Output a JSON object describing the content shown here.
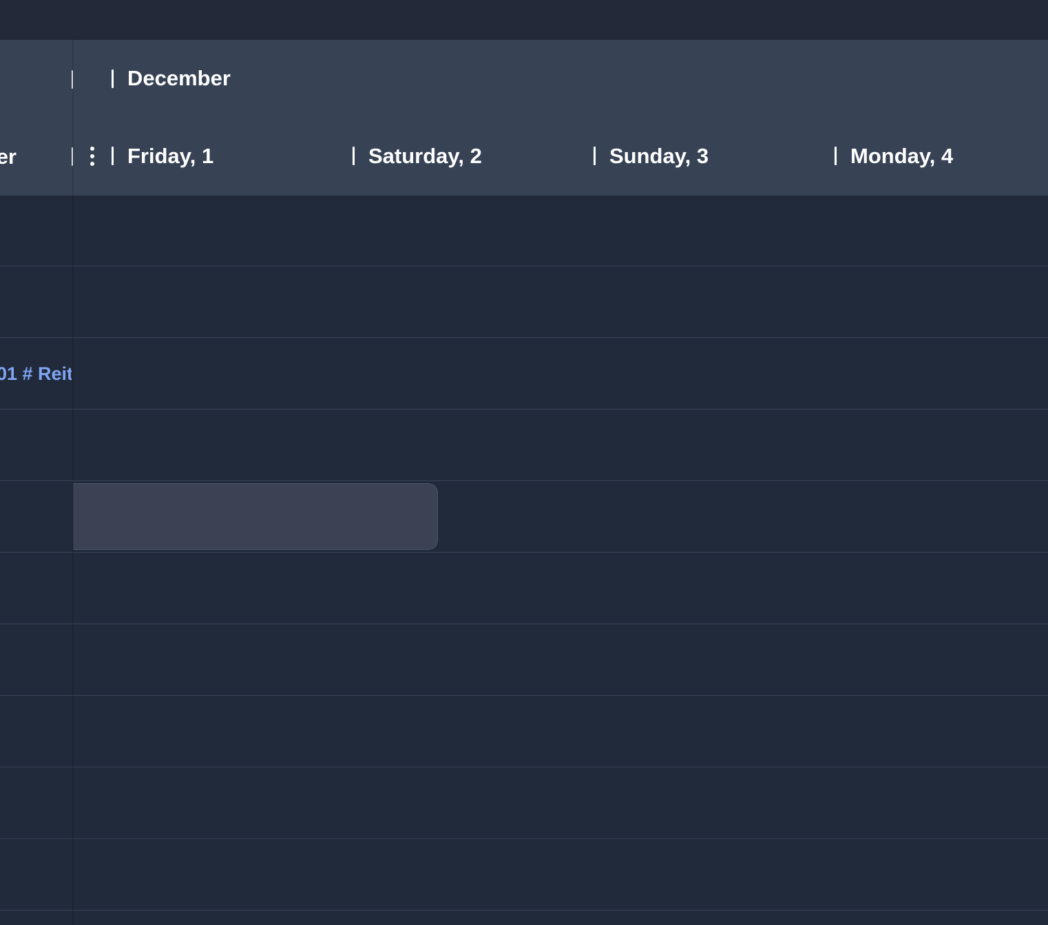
{
  "header": {
    "month": "December",
    "days": [
      "Friday, 1",
      "Saturday, 2",
      "Sunday, 3",
      "Monday, 4"
    ],
    "left_fragment": "er"
  },
  "rows": {
    "label_fragment": "01 # Reit"
  },
  "colors": {
    "background": "#212a3b",
    "header": "#374254",
    "topbar": "#222938",
    "gridline": "#3a4457",
    "event": "#3a4253",
    "link": "#7fa5f2"
  },
  "icons": {
    "kebab": "more-vertical-icon"
  }
}
